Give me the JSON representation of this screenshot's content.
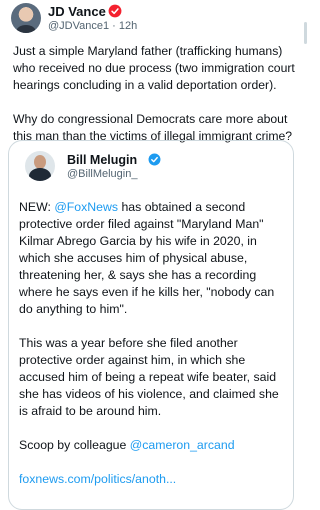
{
  "post": {
    "author_name": "JD Vance",
    "handle": "@JDVance1",
    "separator": "·",
    "time": "12h",
    "paragraphs": [
      "Just a simple Maryland father (trafficking humans) who received no due process (two immigration court hearings concluding in a valid deportation order).",
      "Why do congressional Democrats care more about this man than the victims of illegal immigrant crime?"
    ]
  },
  "quote": {
    "author_name": "Bill Melugin",
    "handle": "@BillMelugin_",
    "p1_prefix": "NEW: ",
    "p1_mention": "@FoxNews",
    "p1_rest": " has obtained a second protective order filed against \"Maryland Man\" Kilmar Abrego Garcia by his wife in 2020, in which she accuses him of physical abuse, threatening her, & says she has a recording where he says even if he kills her, \"nobody can do anything to him\".",
    "p2": "This was a year before she filed another protective order against him, in which she accused him of being a repeat wife beater, said she has videos of his violence, and claimed she is afraid to be around him.",
    "p3_prefix": "Scoop by colleague ",
    "p3_mention": "@cameron_arcand",
    "link": "foxnews.com/politics/anoth..."
  },
  "colors": {
    "accent": "#1d9bf0",
    "badge_red": "#f4212e",
    "text": "#0f1419",
    "muted": "#536471"
  },
  "icons": {
    "author_badge": "verified-badge-icon",
    "quote_badge": "verified-badge-icon"
  }
}
